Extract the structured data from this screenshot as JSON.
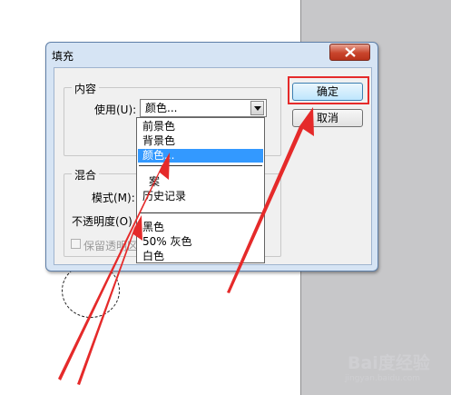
{
  "dialog": {
    "title": "填充",
    "ok_label": "确定",
    "cancel_label": "取消",
    "content_group": {
      "legend": "内容",
      "use_label": "使用(U):",
      "use_value": "颜色..."
    },
    "blend_group": {
      "legend": "混合",
      "mode_label": "模式(M):",
      "opacity_label": "不透明度(O)",
      "preserve_label": "保留透明区域"
    }
  },
  "dropdown": {
    "options": [
      "前景色",
      "背景色",
      "颜色...",
      "图案",
      "历史记录",
      "黑色",
      "50% 灰色",
      "白色"
    ],
    "visible_text": {
      "pattern": "案",
      "history": "历史记录"
    },
    "selected": "颜色..."
  },
  "watermark": {
    "logo": "Bai度经验",
    "url": "jingyan.baidu.com"
  },
  "colors": {
    "annotation": "#e52a2a",
    "selection": "#3399ff",
    "dialog_frame": "#d6e4f4"
  },
  "icons": {
    "close": "close-icon",
    "dropdown_arrow": "chevron-down-icon"
  }
}
